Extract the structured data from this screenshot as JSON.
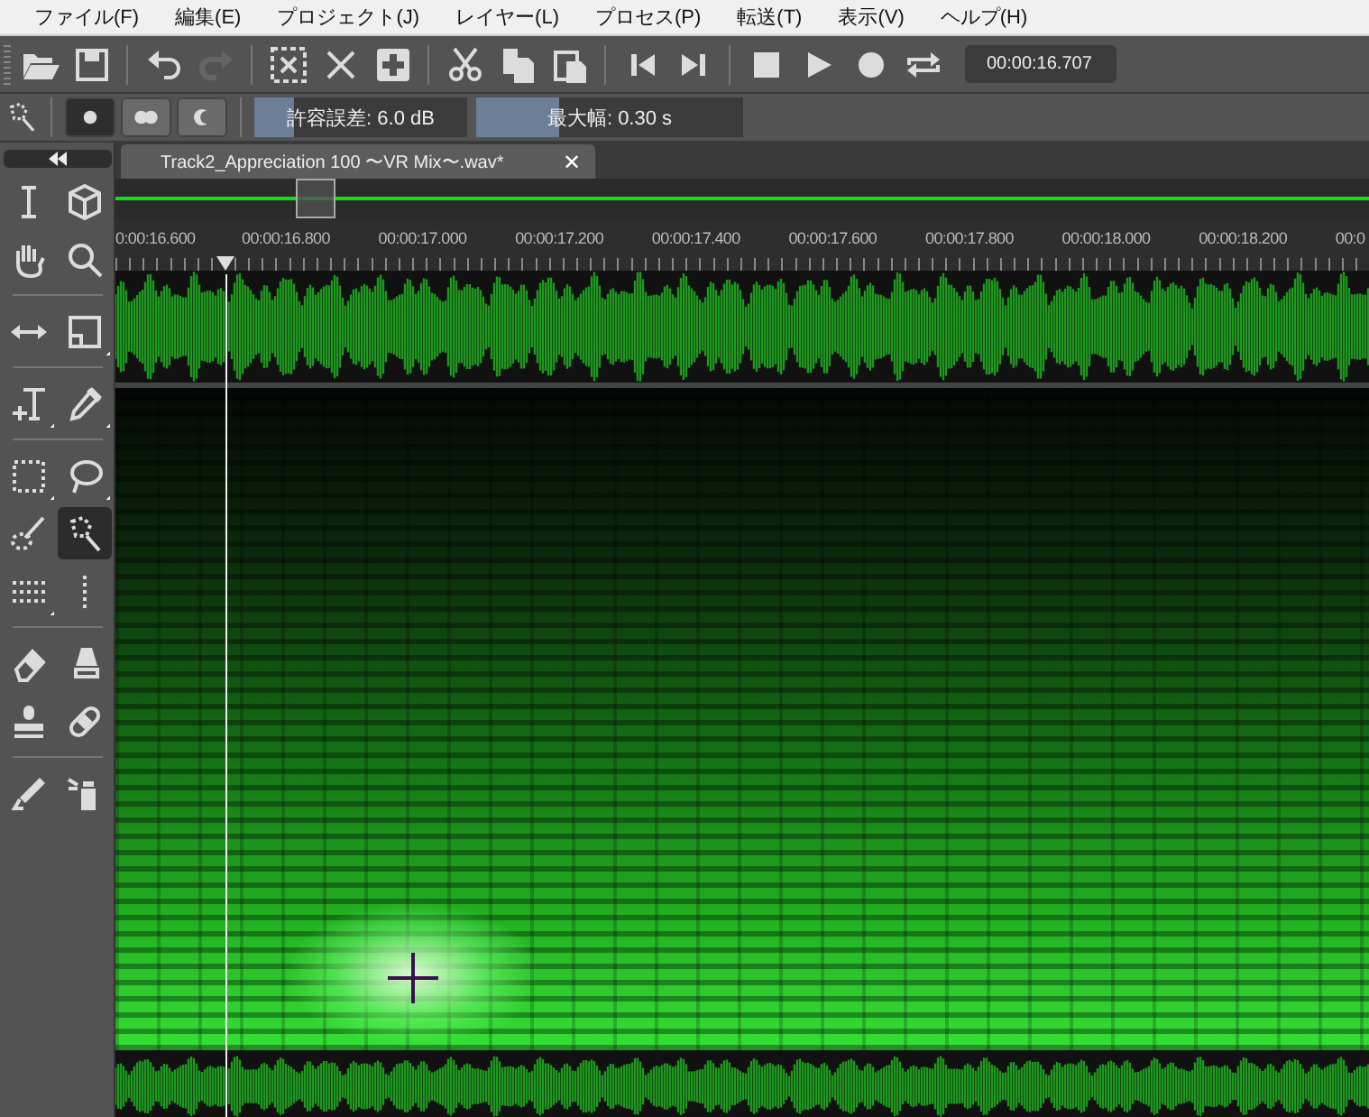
{
  "menu": [
    "ファイル(F)",
    "編集(E)",
    "プロジェクト(J)",
    "レイヤー(L)",
    "プロセス(P)",
    "転送(T)",
    "表示(V)",
    "ヘルプ(H)"
  ],
  "toolbar": {
    "buttons": [
      {
        "kind": "open",
        "disabled": false
      },
      {
        "kind": "save",
        "disabled": false
      },
      {
        "kind": "sep"
      },
      {
        "kind": "undo",
        "disabled": false
      },
      {
        "kind": "redo",
        "disabled": true
      },
      {
        "kind": "sep"
      },
      {
        "kind": "deselect",
        "disabled": false
      },
      {
        "kind": "delete",
        "disabled": false
      },
      {
        "kind": "add",
        "disabled": false
      },
      {
        "kind": "sep"
      },
      {
        "kind": "cut",
        "disabled": false
      },
      {
        "kind": "copy",
        "disabled": false
      },
      {
        "kind": "paste",
        "disabled": false
      },
      {
        "kind": "sep"
      },
      {
        "kind": "prev",
        "disabled": false
      },
      {
        "kind": "next",
        "disabled": false
      },
      {
        "kind": "sep"
      },
      {
        "kind": "stop",
        "disabled": false
      },
      {
        "kind": "play",
        "disabled": false
      },
      {
        "kind": "record",
        "disabled": false
      },
      {
        "kind": "loop",
        "disabled": false
      }
    ],
    "time": "00:00:16.707"
  },
  "options": {
    "modes": [
      {
        "kind": "single",
        "selected": true
      },
      {
        "kind": "add",
        "selected": false
      },
      {
        "kind": "subtract",
        "selected": false
      }
    ],
    "fields": [
      {
        "label": "許容誤差: 6.0 dB",
        "level": 0.19
      },
      {
        "label": "最大幅: 0.30 s",
        "level": 0.31
      }
    ]
  },
  "tools": [
    [
      {
        "kind": "ibeam",
        "selected": false,
        "menu": false
      },
      {
        "kind": "cube",
        "selected": false,
        "menu": false
      },
      {
        "kind": "hand",
        "selected": false,
        "menu": false
      },
      {
        "kind": "search",
        "selected": false,
        "menu": false
      }
    ],
    [
      {
        "kind": "arrows",
        "selected": false,
        "menu": false
      },
      {
        "kind": "corner",
        "selected": false,
        "menu": true
      }
    ],
    [
      {
        "kind": "text",
        "selected": false,
        "menu": true
      },
      {
        "kind": "dropper",
        "selected": false,
        "menu": true
      }
    ],
    [
      {
        "kind": "rect",
        "selected": false,
        "menu": true
      },
      {
        "kind": "lasso",
        "selected": false,
        "menu": true
      },
      {
        "kind": "brush",
        "selected": false,
        "menu": false
      },
      {
        "kind": "wand",
        "selected": true,
        "menu": false
      },
      {
        "kind": "lines",
        "selected": false,
        "menu": true
      },
      {
        "kind": "vdots",
        "selected": false,
        "menu": false
      }
    ],
    [
      {
        "kind": "eraser",
        "selected": false,
        "menu": false
      },
      {
        "kind": "marker",
        "selected": false,
        "menu": false
      },
      {
        "kind": "stamp",
        "selected": false,
        "menu": false
      },
      {
        "kind": "bandage",
        "selected": false,
        "menu": false
      }
    ],
    [
      {
        "kind": "pen",
        "selected": false,
        "menu": false
      },
      {
        "kind": "spray",
        "selected": false,
        "menu": false
      }
    ]
  ],
  "tab": {
    "title": "Track2_Appreciation 100 〜VR Mix〜.wav*",
    "close": "✕"
  },
  "ruler": [
    "0:00:16.600",
    "00:00:16.800",
    "00:00:17.000",
    "00:00:17.200",
    "00:00:17.400",
    "00:00:17.600",
    "00:00:17.800",
    "00:00:18.000",
    "00:00:18.200",
    "00:0"
  ]
}
